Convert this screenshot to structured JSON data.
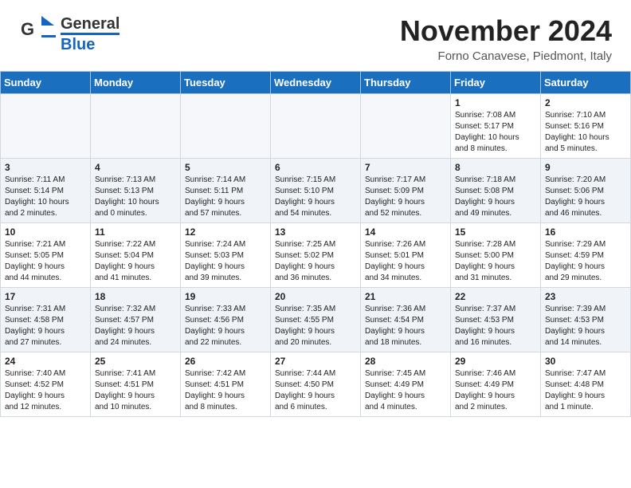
{
  "header": {
    "logo_general": "General",
    "logo_blue": "Blue",
    "month": "November 2024",
    "location": "Forno Canavese, Piedmont, Italy"
  },
  "days_of_week": [
    "Sunday",
    "Monday",
    "Tuesday",
    "Wednesday",
    "Thursday",
    "Friday",
    "Saturday"
  ],
  "weeks": [
    [
      {
        "num": "",
        "info": ""
      },
      {
        "num": "",
        "info": ""
      },
      {
        "num": "",
        "info": ""
      },
      {
        "num": "",
        "info": ""
      },
      {
        "num": "",
        "info": ""
      },
      {
        "num": "1",
        "info": "Sunrise: 7:08 AM\nSunset: 5:17 PM\nDaylight: 10 hours\nand 8 minutes."
      },
      {
        "num": "2",
        "info": "Sunrise: 7:10 AM\nSunset: 5:16 PM\nDaylight: 10 hours\nand 5 minutes."
      }
    ],
    [
      {
        "num": "3",
        "info": "Sunrise: 7:11 AM\nSunset: 5:14 PM\nDaylight: 10 hours\nand 2 minutes."
      },
      {
        "num": "4",
        "info": "Sunrise: 7:13 AM\nSunset: 5:13 PM\nDaylight: 10 hours\nand 0 minutes."
      },
      {
        "num": "5",
        "info": "Sunrise: 7:14 AM\nSunset: 5:11 PM\nDaylight: 9 hours\nand 57 minutes."
      },
      {
        "num": "6",
        "info": "Sunrise: 7:15 AM\nSunset: 5:10 PM\nDaylight: 9 hours\nand 54 minutes."
      },
      {
        "num": "7",
        "info": "Sunrise: 7:17 AM\nSunset: 5:09 PM\nDaylight: 9 hours\nand 52 minutes."
      },
      {
        "num": "8",
        "info": "Sunrise: 7:18 AM\nSunset: 5:08 PM\nDaylight: 9 hours\nand 49 minutes."
      },
      {
        "num": "9",
        "info": "Sunrise: 7:20 AM\nSunset: 5:06 PM\nDaylight: 9 hours\nand 46 minutes."
      }
    ],
    [
      {
        "num": "10",
        "info": "Sunrise: 7:21 AM\nSunset: 5:05 PM\nDaylight: 9 hours\nand 44 minutes."
      },
      {
        "num": "11",
        "info": "Sunrise: 7:22 AM\nSunset: 5:04 PM\nDaylight: 9 hours\nand 41 minutes."
      },
      {
        "num": "12",
        "info": "Sunrise: 7:24 AM\nSunset: 5:03 PM\nDaylight: 9 hours\nand 39 minutes."
      },
      {
        "num": "13",
        "info": "Sunrise: 7:25 AM\nSunset: 5:02 PM\nDaylight: 9 hours\nand 36 minutes."
      },
      {
        "num": "14",
        "info": "Sunrise: 7:26 AM\nSunset: 5:01 PM\nDaylight: 9 hours\nand 34 minutes."
      },
      {
        "num": "15",
        "info": "Sunrise: 7:28 AM\nSunset: 5:00 PM\nDaylight: 9 hours\nand 31 minutes."
      },
      {
        "num": "16",
        "info": "Sunrise: 7:29 AM\nSunset: 4:59 PM\nDaylight: 9 hours\nand 29 minutes."
      }
    ],
    [
      {
        "num": "17",
        "info": "Sunrise: 7:31 AM\nSunset: 4:58 PM\nDaylight: 9 hours\nand 27 minutes."
      },
      {
        "num": "18",
        "info": "Sunrise: 7:32 AM\nSunset: 4:57 PM\nDaylight: 9 hours\nand 24 minutes."
      },
      {
        "num": "19",
        "info": "Sunrise: 7:33 AM\nSunset: 4:56 PM\nDaylight: 9 hours\nand 22 minutes."
      },
      {
        "num": "20",
        "info": "Sunrise: 7:35 AM\nSunset: 4:55 PM\nDaylight: 9 hours\nand 20 minutes."
      },
      {
        "num": "21",
        "info": "Sunrise: 7:36 AM\nSunset: 4:54 PM\nDaylight: 9 hours\nand 18 minutes."
      },
      {
        "num": "22",
        "info": "Sunrise: 7:37 AM\nSunset: 4:53 PM\nDaylight: 9 hours\nand 16 minutes."
      },
      {
        "num": "23",
        "info": "Sunrise: 7:39 AM\nSunset: 4:53 PM\nDaylight: 9 hours\nand 14 minutes."
      }
    ],
    [
      {
        "num": "24",
        "info": "Sunrise: 7:40 AM\nSunset: 4:52 PM\nDaylight: 9 hours\nand 12 minutes."
      },
      {
        "num": "25",
        "info": "Sunrise: 7:41 AM\nSunset: 4:51 PM\nDaylight: 9 hours\nand 10 minutes."
      },
      {
        "num": "26",
        "info": "Sunrise: 7:42 AM\nSunset: 4:51 PM\nDaylight: 9 hours\nand 8 minutes."
      },
      {
        "num": "27",
        "info": "Sunrise: 7:44 AM\nSunset: 4:50 PM\nDaylight: 9 hours\nand 6 minutes."
      },
      {
        "num": "28",
        "info": "Sunrise: 7:45 AM\nSunset: 4:49 PM\nDaylight: 9 hours\nand 4 minutes."
      },
      {
        "num": "29",
        "info": "Sunrise: 7:46 AM\nSunset: 4:49 PM\nDaylight: 9 hours\nand 2 minutes."
      },
      {
        "num": "30",
        "info": "Sunrise: 7:47 AM\nSunset: 4:48 PM\nDaylight: 9 hours\nand 1 minute."
      }
    ]
  ]
}
